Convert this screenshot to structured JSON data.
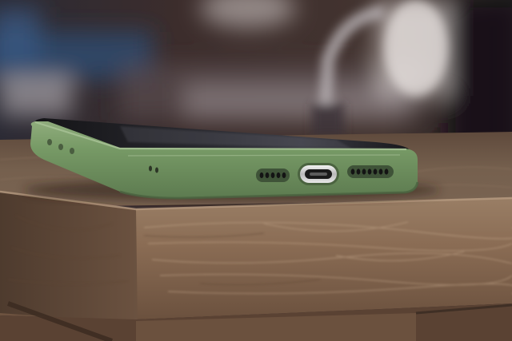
{
  "photo": {
    "subject": "",
    "colors": {
      "case": "#6f8f5f",
      "case_highlight": "#8fac7c",
      "case_shadow": "#4f6a44",
      "screen": "#1e1e22",
      "wood_top": "#6e5644",
      "wood_front": "#8a6e58",
      "wood_dark": "#3f2f25",
      "background_dark": "#2b2427",
      "background_blue": "#2d4a6e",
      "port_metal": "#d9d9d9"
    }
  }
}
